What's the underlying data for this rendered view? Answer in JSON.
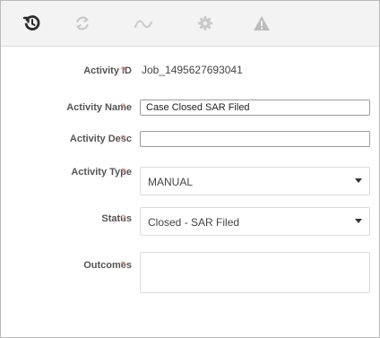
{
  "toolbar": {
    "icons": [
      "history-icon",
      "refresh-icon",
      "trend-icon",
      "gear-icon",
      "warning-icon"
    ]
  },
  "form": {
    "help_mark": "?",
    "activity_id": {
      "label": "Activity ID",
      "value": "Job_1495627693041"
    },
    "activity_name": {
      "label": "Activity Name",
      "value": "Case Closed SAR Filed"
    },
    "activity_desc": {
      "label": "Activity Desc",
      "value": ""
    },
    "activity_type": {
      "label": "Activity Type",
      "value": "MANUAL"
    },
    "status": {
      "label": "Status",
      "value": "Closed - SAR Filed"
    },
    "outcomes": {
      "label": "Outcomes",
      "value": ""
    }
  },
  "colors": {
    "toolbar_bg": "#f3f3f3",
    "icon_dark": "#2b2b2b",
    "icon_light": "#c9c9c9",
    "help_mark": "#e08a8a"
  }
}
